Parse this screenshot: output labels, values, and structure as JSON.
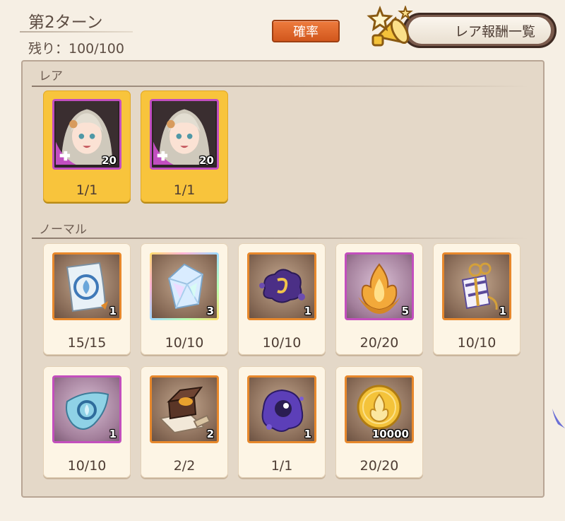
{
  "header": {
    "turn_title": "第2ターン",
    "remaining": "残り：100/100",
    "probability_label": "確率",
    "rare_list_label": "レア報酬一覧"
  },
  "sections": {
    "rare": "レア",
    "normal": "ノーマル"
  },
  "rare_items": [
    {
      "icon": "character-portrait-icon",
      "quantity": "20",
      "count": "1/1"
    },
    {
      "icon": "character-portrait-icon",
      "quantity": "20",
      "count": "1/1"
    }
  ],
  "normal_items": [
    {
      "icon": "blue-scroll-icon",
      "quantity": "1",
      "count": "15/15"
    },
    {
      "icon": "crystal-icon",
      "quantity": "3",
      "count": "10/10"
    },
    {
      "icon": "purple-slime-icon",
      "quantity": "1",
      "count": "10/10"
    },
    {
      "icon": "golden-flame-icon",
      "quantity": "5",
      "count": "20/20"
    },
    {
      "icon": "gift-box-icon",
      "quantity": "1",
      "count": "10/10"
    },
    {
      "icon": "blue-crystal-shard-icon",
      "quantity": "1",
      "count": "10/10"
    },
    {
      "icon": "treasure-chest-icon",
      "quantity": "2",
      "count": "2/2"
    },
    {
      "icon": "purple-orb-icon",
      "quantity": "1",
      "count": "1/1"
    },
    {
      "icon": "gold-coin-icon",
      "quantity": "10000",
      "count": "20/20"
    }
  ],
  "colors": {
    "rare_card": "#f8c43c",
    "normal_card": "#fdf5e5",
    "probability_button": "#e06a2c",
    "frame_orange": "#e7882c",
    "frame_purple": "#c34fbd"
  }
}
